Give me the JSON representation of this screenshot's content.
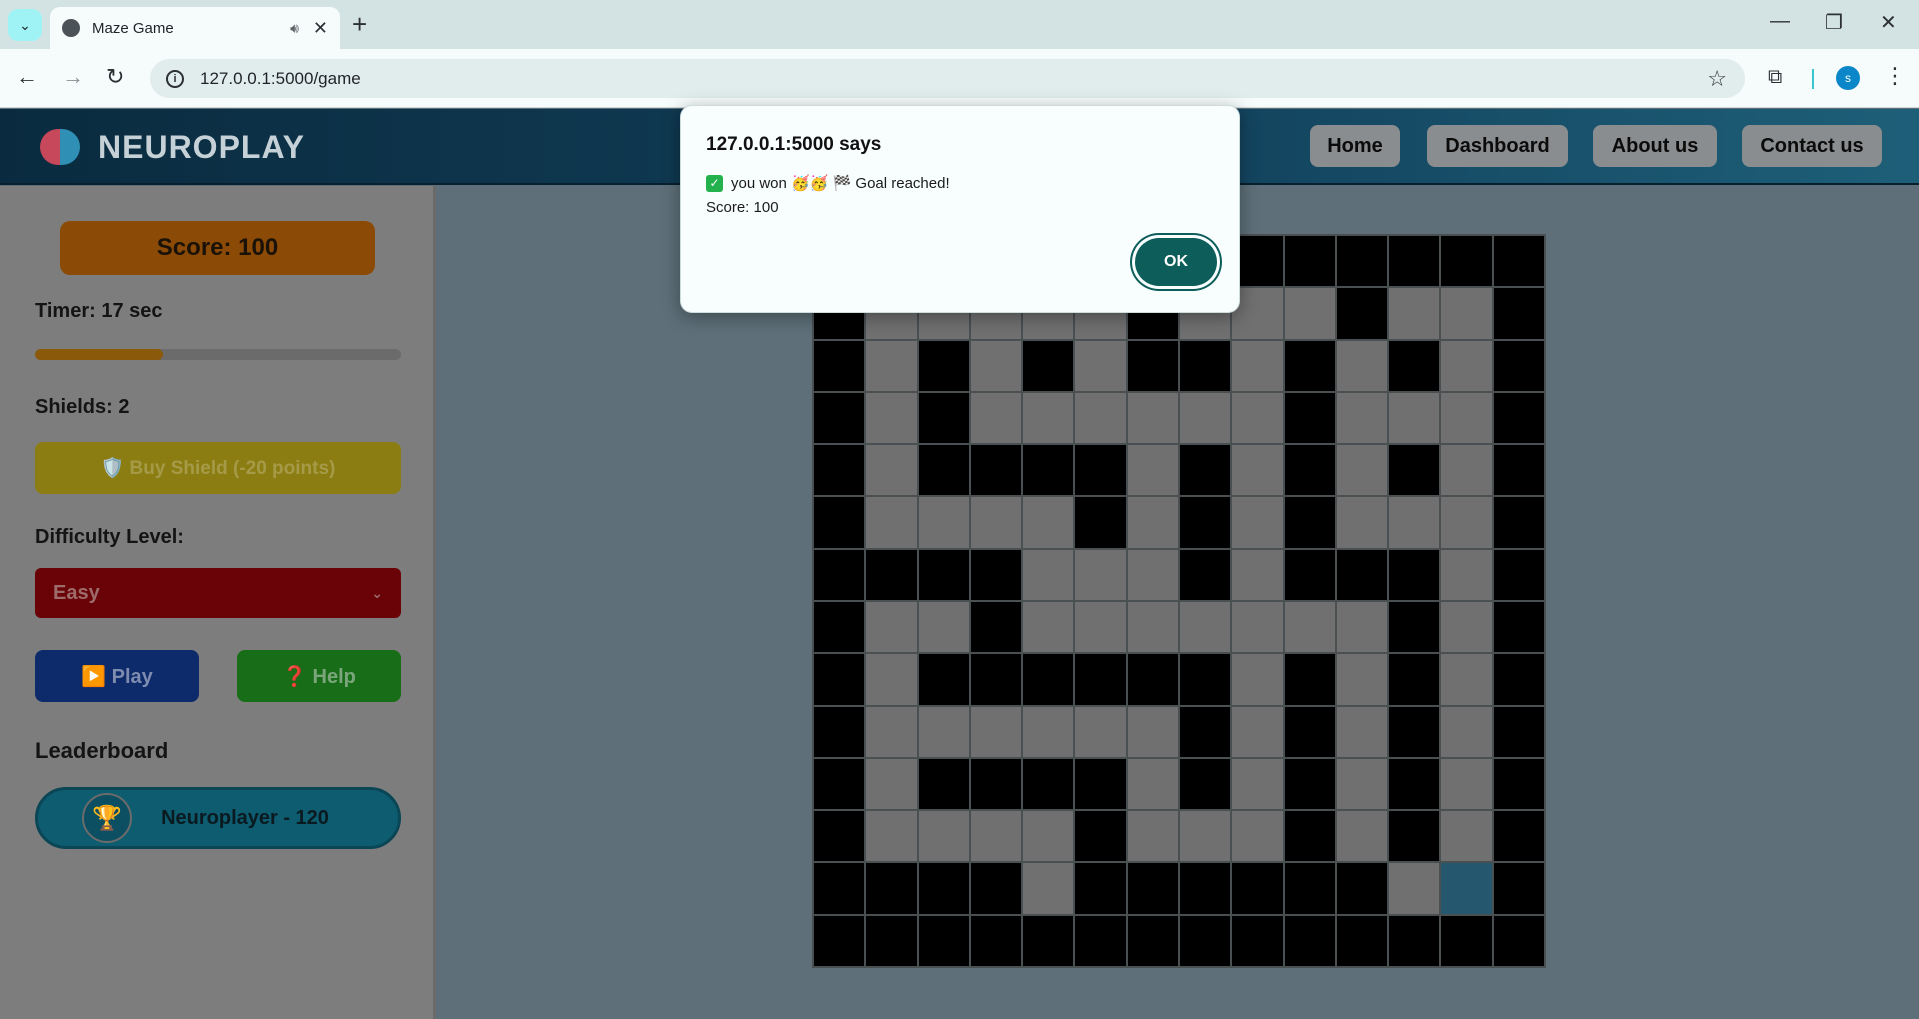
{
  "browser": {
    "tab_title": "Maze Game",
    "url": "127.0.0.1:5000/game",
    "profile_initial": "s"
  },
  "header": {
    "logo_text": "NEUROPLAY",
    "nav": [
      "Home",
      "Dashboard",
      "About us",
      "Contact us"
    ]
  },
  "sidebar": {
    "score_label": "Score: 100",
    "timer_label": "Timer: 17 sec",
    "timer_progress": 0.35,
    "shields_label": "Shields: 2",
    "buy_shield_label": "🛡️ Buy Shield (-20 points)",
    "difficulty_heading": "Difficulty Level:",
    "difficulty_value": "Easy",
    "play_label": "▶️ Play",
    "help_label": "❓ Help",
    "leaderboard_heading": "Leaderboard",
    "leaderboard_entry": "Neuroplayer - 120",
    "trophy_glyph": "🏆"
  },
  "maze": {
    "rows": [
      "##############",
      "#.....#...#..#",
      "#.#.#.##.#.#.#",
      "#.#......#...#",
      "#.####.#.#.#.#",
      "#....#.#.#...#",
      "####...#.###.#",
      "#..#.......#.#",
      "#.######.#.#.#",
      "#......#.#.#.#",
      "#.####.#.#.#.#",
      "#....#...#.#.#",
      "####.######.G#",
      "##############"
    ]
  },
  "dialog": {
    "title": "127.0.0.1:5000 says",
    "message": "you won 🥳🥳 🏁 Goal reached!",
    "score_line": "Score: 100",
    "ok_label": "OK"
  }
}
